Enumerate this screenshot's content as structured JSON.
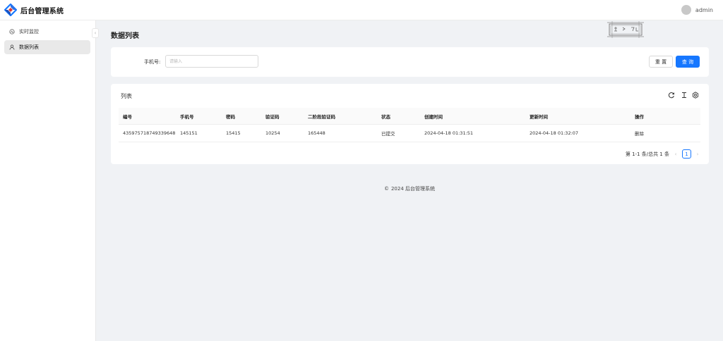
{
  "header": {
    "app_title": "后台管理系统",
    "username": "admin"
  },
  "sidebar": {
    "items": [
      {
        "label": "实时监控",
        "icon": "monitor-icon",
        "active": false
      },
      {
        "label": "数据列表",
        "icon": "user-icon",
        "active": true
      }
    ],
    "collapse_icon": "chevron-left-icon"
  },
  "main": {
    "page_title": "数据列表",
    "search": {
      "phone_label": "手机号:",
      "phone_placeholder": "请输入",
      "phone_value": "",
      "reset_label": "重 置",
      "query_label": "查 询"
    },
    "table": {
      "title": "列表",
      "tools": [
        "reload-icon",
        "column-height-icon",
        "setting-icon"
      ],
      "columns": [
        "编号",
        "手机号",
        "密码",
        "验证码",
        "二阶段验证码",
        "状态",
        "创建时间",
        "更新时间",
        "操作"
      ],
      "rows": [
        {
          "id": "435975718749339648",
          "phone": "145151",
          "password": "15415",
          "code": "10254",
          "code2": "165448",
          "status": "已提交",
          "created": "2024-04-18 01:31:51",
          "updated": "2024-04-18 01:32:07",
          "action": "删除"
        }
      ]
    },
    "pagination": {
      "summary": "第 1-1 条/总共 1 条",
      "current_page": "1"
    }
  },
  "footer": {
    "copyright_symbol": "©",
    "text": "2024 后台管理系统"
  },
  "colors": {
    "primary": "#1677ff",
    "background": "#f0f2f5"
  }
}
